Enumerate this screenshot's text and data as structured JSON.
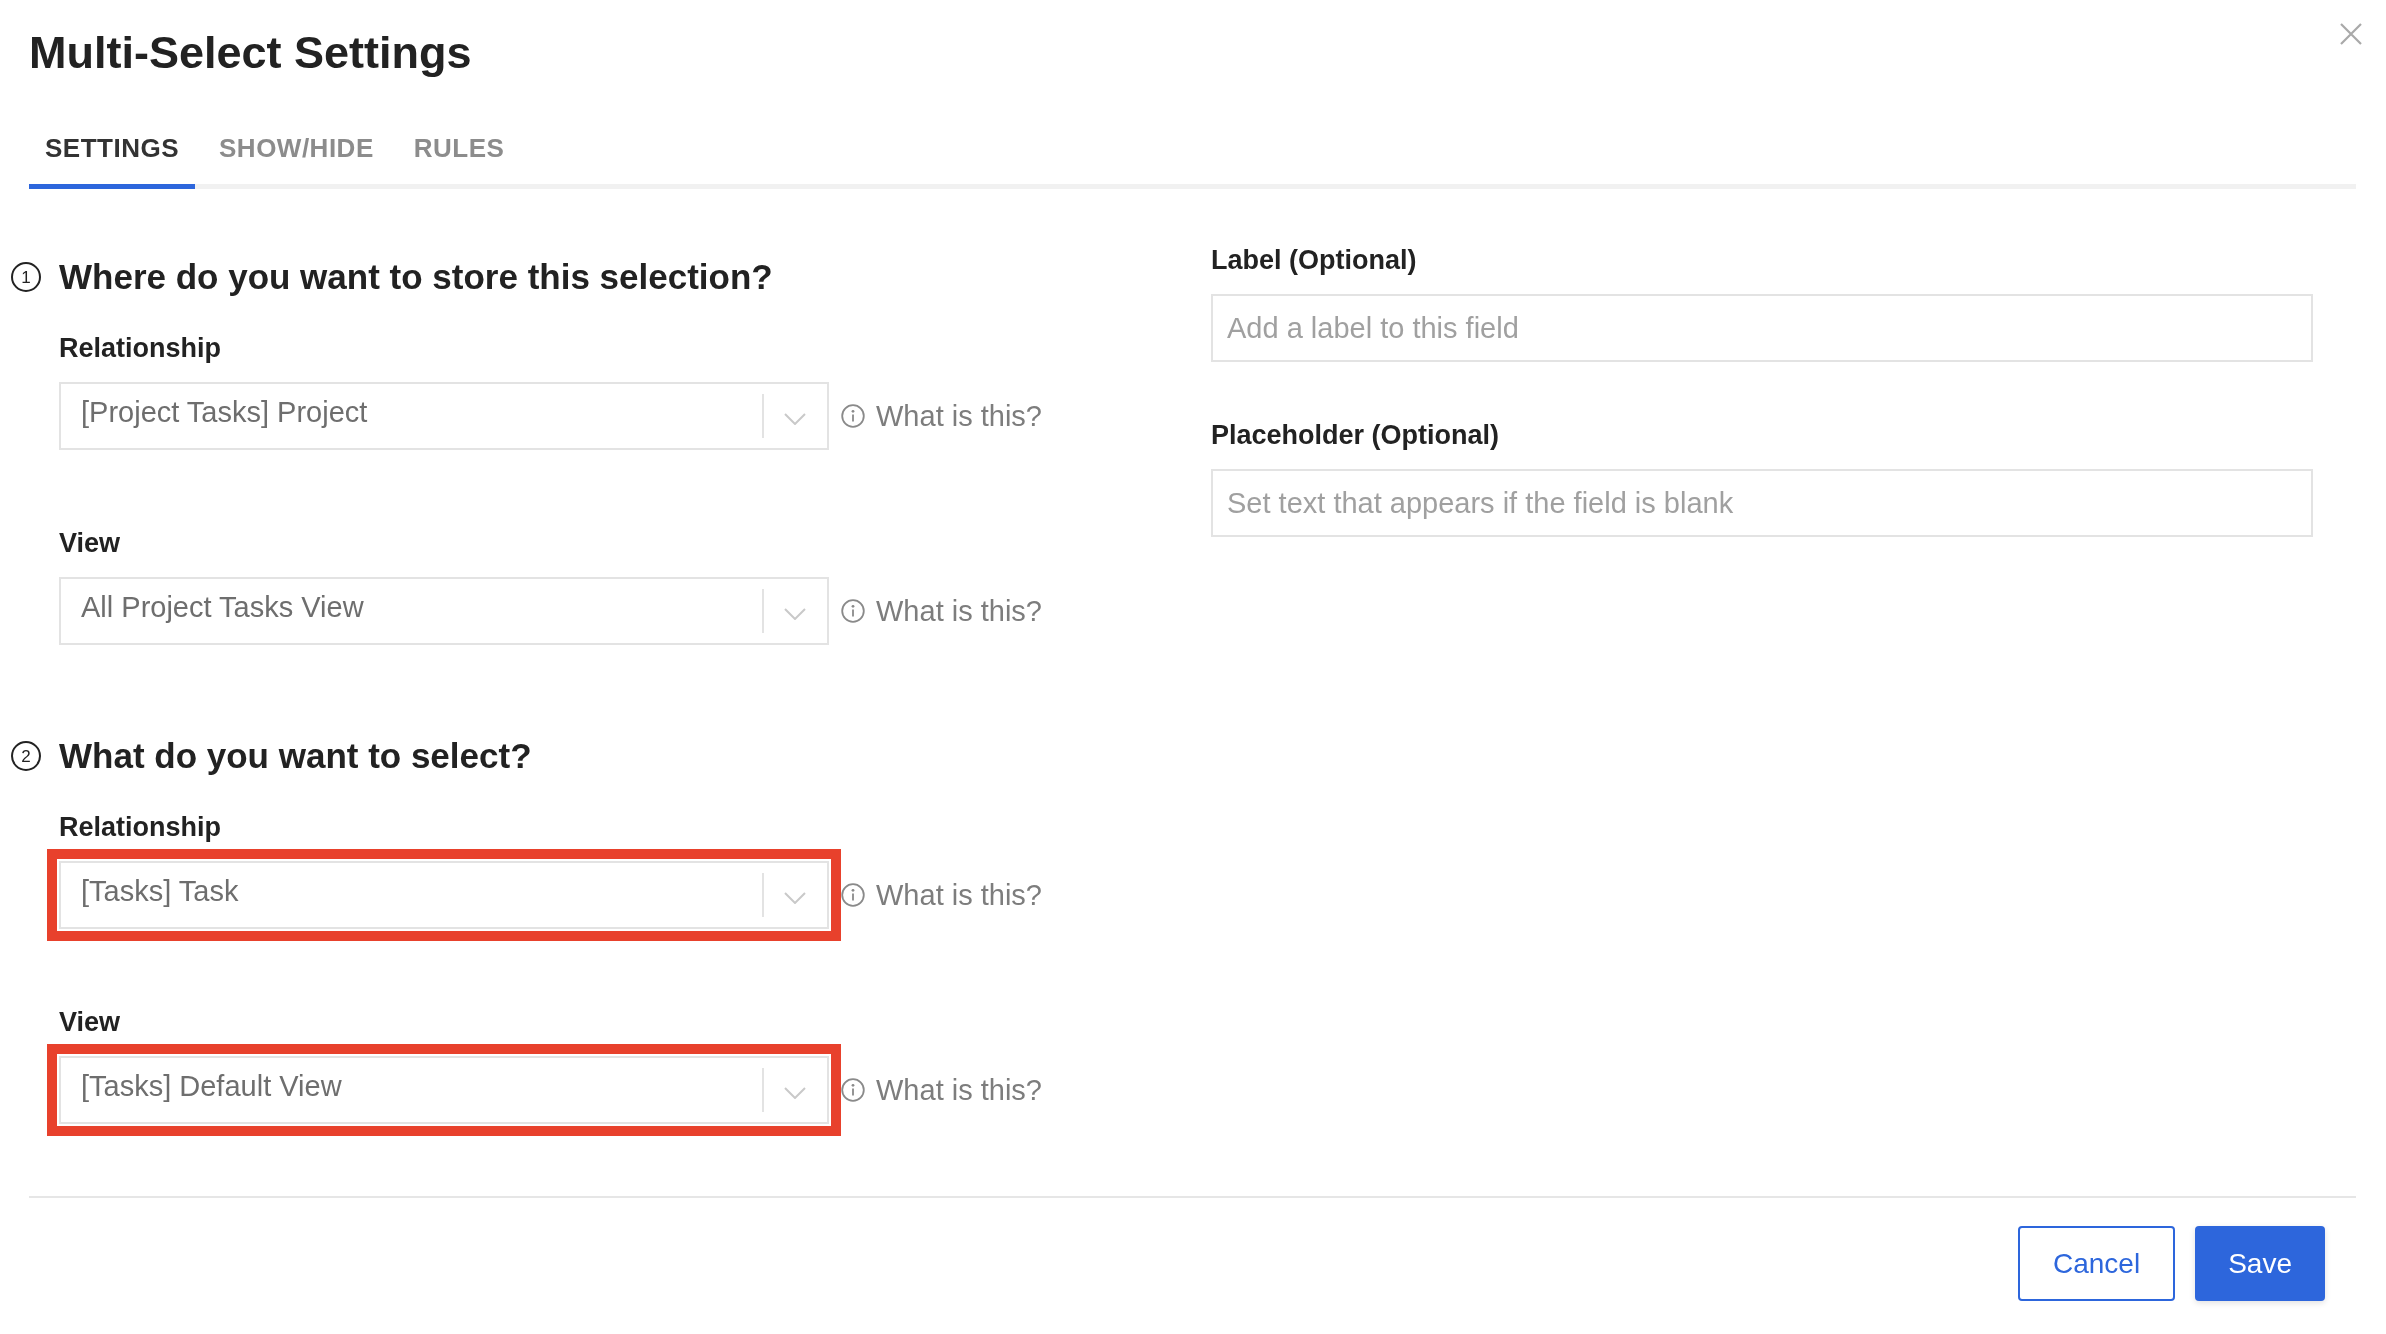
{
  "dialog": {
    "title": "Multi-Select Settings"
  },
  "tabs": [
    {
      "label": "SETTINGS",
      "selected": true
    },
    {
      "label": "SHOW/HIDE",
      "selected": false
    },
    {
      "label": "RULES",
      "selected": false
    }
  ],
  "sections": [
    {
      "number": "1",
      "heading": "Where do you want to store this selection?",
      "fields": [
        {
          "label": "Relationship",
          "value": "[Project Tasks] Project",
          "help": "What is this?",
          "highlighted": false
        },
        {
          "label": "View",
          "value": "All Project Tasks View",
          "help": "What is this?",
          "highlighted": false
        }
      ]
    },
    {
      "number": "2",
      "heading": "What do you want to select?",
      "fields": [
        {
          "label": "Relationship",
          "value": "[Tasks] Task",
          "help": "What is this?",
          "highlighted": true
        },
        {
          "label": "View",
          "value": "[Tasks] Default View",
          "help": "What is this?",
          "highlighted": true
        }
      ]
    }
  ],
  "optional_fields": [
    {
      "label": "Label (Optional)",
      "placeholder": "Add a label to this field"
    },
    {
      "label": "Placeholder (Optional)",
      "placeholder": "Set text that appears if the field is blank"
    }
  ],
  "buttons": [
    {
      "label": "Cancel",
      "kind": "cancel"
    },
    {
      "label": "Save",
      "kind": "save"
    }
  ]
}
